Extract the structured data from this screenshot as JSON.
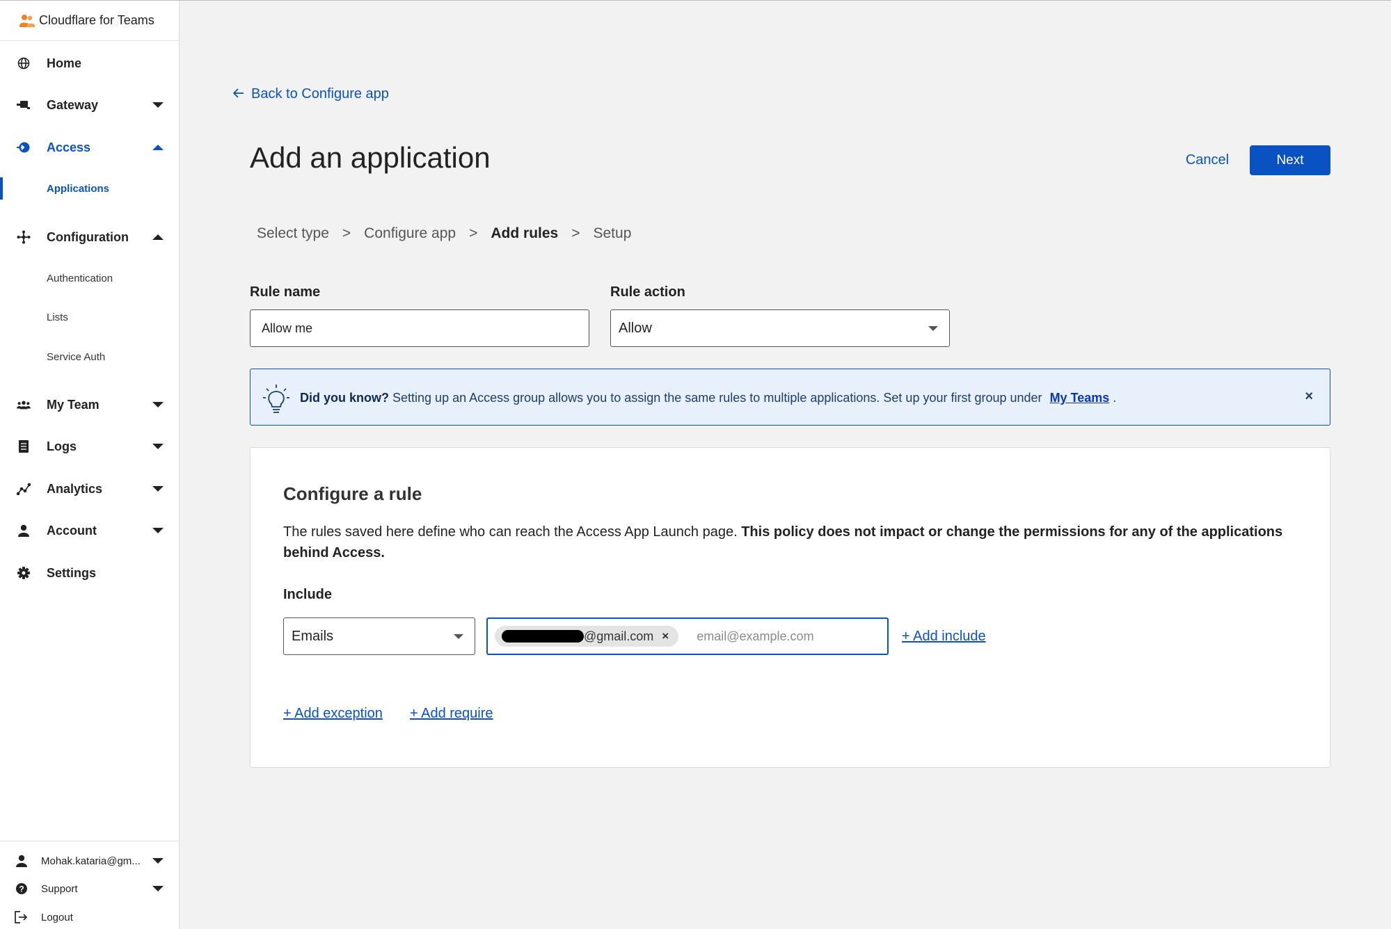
{
  "app": {
    "title": "Cloudflare for Teams"
  },
  "sidebar": {
    "items": [
      {
        "label": "Home",
        "icon": "globe-icon"
      },
      {
        "label": "Gateway",
        "icon": "gateway-icon"
      },
      {
        "label": "Access",
        "icon": "access-icon"
      },
      {
        "label": "Configuration",
        "icon": "configuration-icon"
      },
      {
        "label": "My Team",
        "icon": "team-icon"
      },
      {
        "label": "Logs",
        "icon": "logs-icon"
      },
      {
        "label": "Analytics",
        "icon": "analytics-icon"
      },
      {
        "label": "Account",
        "icon": "account-icon"
      },
      {
        "label": "Settings",
        "icon": "gear-icon"
      }
    ],
    "access_sub": [
      {
        "label": "Applications"
      }
    ],
    "configuration_sub": [
      {
        "label": "Authentication"
      },
      {
        "label": "Lists"
      },
      {
        "label": "Service Auth"
      }
    ],
    "bottom": {
      "user": "Mohak.kataria@gm...",
      "support": "Support",
      "logout": "Logout"
    }
  },
  "header": {
    "back_link": "Back to Configure app",
    "title": "Add an application",
    "cancel_label": "Cancel",
    "next_label": "Next"
  },
  "steps": [
    {
      "label": "Select type"
    },
    {
      "label": "Configure app"
    },
    {
      "label": "Add rules"
    },
    {
      "label": "Setup"
    }
  ],
  "steps_separator": ">",
  "form": {
    "rule_name_label": "Rule name",
    "rule_name_value": "Allow me",
    "rule_action_label": "Rule action",
    "rule_action_value": "Allow"
  },
  "tip": {
    "heading": "Did you know?",
    "text": "Setting up an Access group allows you to assign the same rules to multiple applications. Set up your first group under",
    "link": "My Teams",
    "suffix": ".",
    "close": "×"
  },
  "rule": {
    "title": "Configure a rule",
    "desc_plain": "The rules saved here define who can reach the Access App Launch page.",
    "desc_bold": "This policy does not impact or change the permissions for any of the applications behind Access.",
    "include_label": "Include",
    "include_selector": "Emails",
    "email_chip_domain": "@gmail.com",
    "email_chip_remove": "×",
    "email_placeholder": "email@example.com",
    "add_include": "+ Add include",
    "add_exception": "+ Add exception",
    "add_require": "+ Add require"
  },
  "colors": {
    "accent": "#0a51c2",
    "tip_background": "#e8f1fb",
    "brand_orange": "#f48120"
  }
}
